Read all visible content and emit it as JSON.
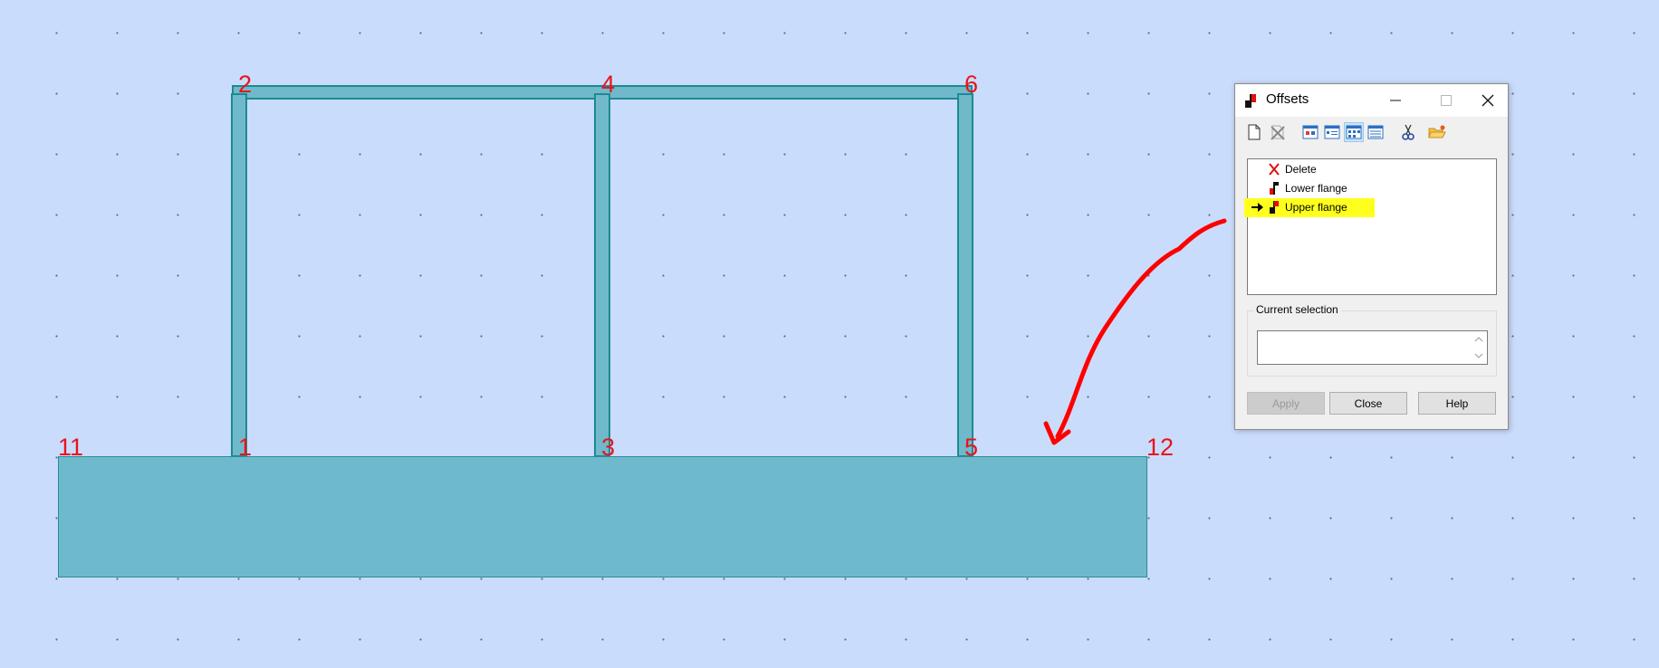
{
  "canvas": {
    "node_labels": {
      "n1": "1",
      "n2": "2",
      "n3": "3",
      "n4": "4",
      "n5": "5",
      "n6": "6",
      "n11": "11",
      "n12": "12"
    }
  },
  "dialog": {
    "title": "Offsets",
    "icon": "offsets-flange-icon",
    "window_controls": [
      "minimize-icon",
      "maximize-icon",
      "close-icon"
    ],
    "toolbar": [
      "new-icon",
      "delete-icon",
      "view-1-icon",
      "view-2-icon",
      "view-3-icon",
      "view-4-icon",
      "cut-icon",
      "open-folder-icon"
    ],
    "list": [
      {
        "label": "Delete",
        "icon": "red-x-icon",
        "selected": false
      },
      {
        "label": "Lower flange",
        "icon": "flange-icon",
        "selected": false
      },
      {
        "label": "Upper flange",
        "icon": "flange-icon",
        "selected": true
      }
    ],
    "current_selection_title": "Current selection",
    "current_selection_value": "",
    "buttons": {
      "apply": "Apply",
      "close": "Close",
      "help": "Help"
    }
  },
  "annotation": {
    "arrow_color": "#ff0000"
  },
  "colors": {
    "background": "#cadcfc",
    "member_fill": "#70b9ca",
    "member_border": "#1c8a92",
    "node_label": "#e8141c",
    "highlight": "#ffff1e"
  }
}
